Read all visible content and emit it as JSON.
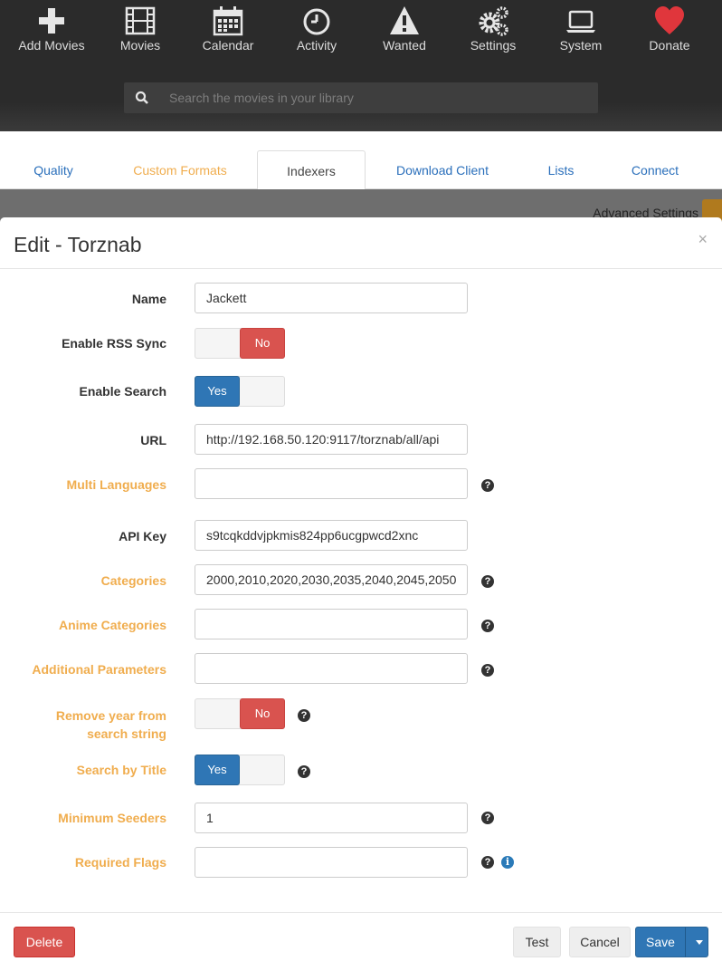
{
  "nav": {
    "items": [
      {
        "label": "Add Movies",
        "icon": "plus-icon"
      },
      {
        "label": "Movies",
        "icon": "film-icon"
      },
      {
        "label": "Calendar",
        "icon": "calendar-icon"
      },
      {
        "label": "Activity",
        "icon": "clock-icon"
      },
      {
        "label": "Wanted",
        "icon": "warning-icon"
      },
      {
        "label": "Settings",
        "icon": "gears-icon"
      },
      {
        "label": "System",
        "icon": "laptop-icon"
      },
      {
        "label": "Donate",
        "icon": "heart-icon"
      }
    ],
    "search_placeholder": "Search the movies in your library"
  },
  "tabs": [
    {
      "label": "Quality"
    },
    {
      "label": "Custom Formats"
    },
    {
      "label": "Indexers"
    },
    {
      "label": "Download Client"
    },
    {
      "label": "Lists"
    },
    {
      "label": "Connect"
    }
  ],
  "advanced_settings_label": "Advanced Settings",
  "modal": {
    "title": "Edit - Torznab",
    "close": "×",
    "fields": {
      "name": {
        "label": "Name",
        "value": "Jackett"
      },
      "rss": {
        "label": "Enable RSS Sync",
        "value": "No"
      },
      "search": {
        "label": "Enable Search",
        "value": "Yes"
      },
      "url": {
        "label": "URL",
        "value": "http://192.168.50.120:9117/torznab/all/api"
      },
      "multi_languages": {
        "label": "Multi Languages",
        "value": ""
      },
      "api_key": {
        "label": "API Key",
        "value": "s9tcqkddvjpkmis824pp6ucgpwcd2xnc"
      },
      "categories": {
        "label": "Categories",
        "value": "2000,2010,2020,2030,2035,2040,2045,2050"
      },
      "anime_categories": {
        "label": "Anime Categories",
        "value": ""
      },
      "additional_parameters": {
        "label": "Additional Parameters",
        "value": ""
      },
      "remove_year_line1": "Remove year from",
      "remove_year_line2": "search string",
      "remove_year_value": "No",
      "search_by_title": {
        "label": "Search by Title",
        "value": "Yes"
      },
      "min_seeders": {
        "label": "Minimum Seeders",
        "value": "1"
      },
      "required_flags": {
        "label": "Required Flags",
        "value": ""
      }
    },
    "help_glyph": "?",
    "info_glyph": "i",
    "buttons": {
      "delete": "Delete",
      "test": "Test",
      "cancel": "Cancel",
      "save": "Save"
    }
  }
}
